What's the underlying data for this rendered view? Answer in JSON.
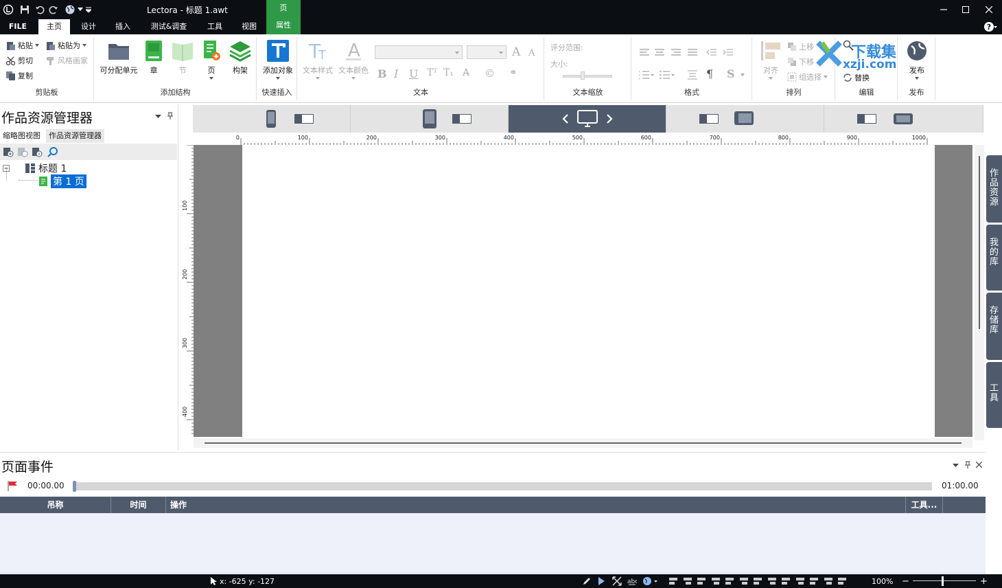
{
  "window": {
    "title": "Lectora - 标题 1.awt",
    "context_group_top": "页",
    "context_group_bottom": "属性"
  },
  "menu": {
    "tabs": [
      {
        "label": "FILE"
      },
      {
        "label": "主页",
        "active": true
      },
      {
        "label": "设计"
      },
      {
        "label": "插入"
      },
      {
        "label": "测试&调查"
      },
      {
        "label": "工具"
      },
      {
        "label": "视图"
      }
    ]
  },
  "ribbon": {
    "clipboard": {
      "paste": "粘贴",
      "paste_as": "粘贴为",
      "cut": "剪切",
      "format_painter": "风格画家",
      "copy": "复制",
      "group_label": "剪贴板"
    },
    "structure": {
      "assignable_unit": "可分配单元",
      "chapter": "章",
      "section": "节",
      "page": "页",
      "frame": "构架",
      "group_label": "添加结构"
    },
    "quick_insert": {
      "add_object": "添加对象",
      "group_label": "快速插入"
    },
    "text": {
      "text_style": "文本样式",
      "text_color": "文本颜色",
      "group_label": "文本"
    },
    "text_scale": {
      "rating_range": "评分范围:",
      "size": "大小:",
      "group_label": "文本缩放"
    },
    "format": {
      "group_label": "格式"
    },
    "arrange": {
      "align": "对齐",
      "move_up": "上移",
      "move_down": "下移",
      "group_select": "组选择",
      "group_label": "排列"
    },
    "edit": {
      "replace": "替换",
      "group_label": "编辑"
    },
    "publish": {
      "publish": "发布",
      "group_label": "发布"
    }
  },
  "watermark": {
    "text": "下载集",
    "domain": "xzji.com"
  },
  "left_panel": {
    "title": "作品资源管理器",
    "tabs": [
      {
        "label": "缩略图视图"
      },
      {
        "label": "作品资源管理器",
        "active": true
      }
    ],
    "tree": {
      "root": "标题 1",
      "page": "第 1 页"
    }
  },
  "ruler": {
    "h_labels": [
      "0",
      "100",
      "200",
      "300",
      "400",
      "500",
      "600",
      "700",
      "800",
      "900",
      "1000"
    ],
    "v_labels": [
      "100",
      "200",
      "300",
      "400"
    ]
  },
  "right_tabs": [
    {
      "label": "作品资源"
    },
    {
      "label": "我的库"
    },
    {
      "label": "存储库"
    },
    {
      "label": "工具"
    }
  ],
  "bottom_panel": {
    "title": "页面事件",
    "time_start": "00:00.00",
    "time_end": "01:00.00",
    "progress": 0,
    "columns": [
      {
        "label": "吊称"
      },
      {
        "label": "时间"
      },
      {
        "label": "操作"
      },
      {
        "label": "工具..."
      }
    ]
  },
  "status": {
    "coords": "x: -625  y: -127",
    "zoom": "100%"
  },
  "colors": {
    "titlebar": "#0b0f14",
    "accent_green": "#2f9947",
    "slate": "#4f5b6c",
    "canvas_gray": "#808080"
  }
}
